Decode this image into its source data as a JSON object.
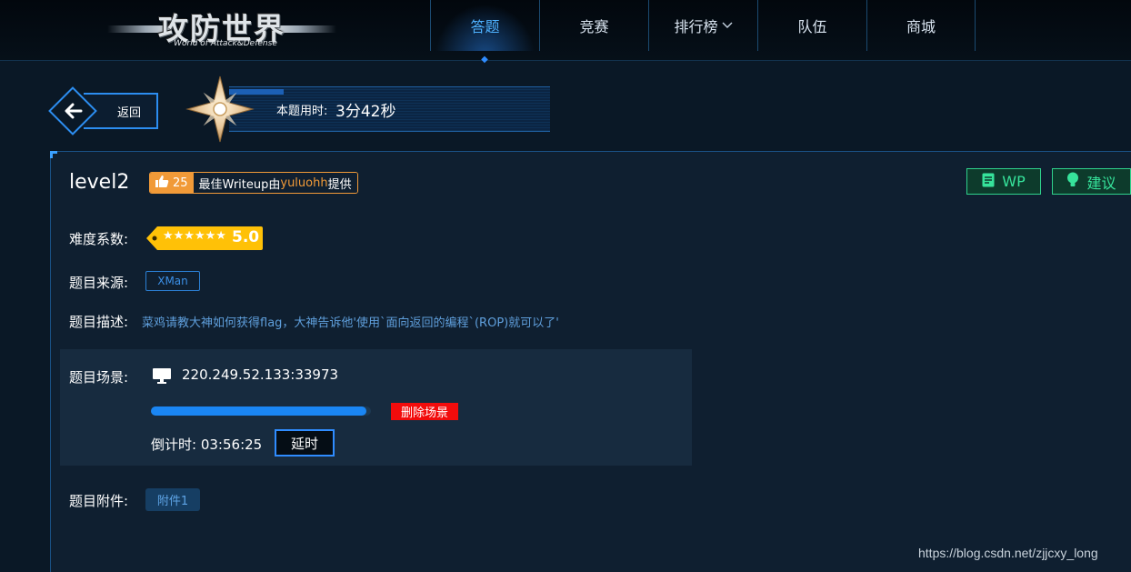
{
  "logo": {
    "title": "攻防世界",
    "subtitle": "World of Attack&Defense"
  },
  "nav": {
    "items": [
      {
        "label": "答题",
        "active": true
      },
      {
        "label": "竞赛",
        "active": false
      },
      {
        "label": "排行榜",
        "active": false,
        "has_dropdown": true
      },
      {
        "label": "队伍",
        "active": false
      },
      {
        "label": "商城",
        "active": false
      }
    ]
  },
  "back_label": "返回",
  "timer": {
    "label": "本题用时:",
    "value": "3分42秒"
  },
  "challenge": {
    "title": "level2",
    "likes": "25",
    "writeup_prefix": "最佳Writeup由",
    "writeup_user": "yuluohh",
    "writeup_suffix": "提供",
    "wp_label": "WP",
    "suggest_label": "建议",
    "difficulty_label": "难度系数:",
    "difficulty_stars": "★★★★★★",
    "difficulty_value": "5.0",
    "source_label": "题目来源:",
    "source": "XMan",
    "desc_label": "题目描述:",
    "description": "菜鸡请教大神如何获得flag，大神告诉他'使用`面向返回的编程`(ROP)就可以了'",
    "scene_label": "题目场景:",
    "scene_address": "220.249.52.133:33973",
    "scene_progress": 0.98,
    "delete_scene_label": "删除场景",
    "countdown_label": "倒计时:",
    "countdown_value": "03:56:25",
    "extend_label": "延时",
    "attach_label": "题目附件:",
    "attachment": "附件1"
  },
  "watermark": "https://blog.csdn.net/zjjcxy_long",
  "colors": {
    "accent_blue": "#2f8cff",
    "like_orange": "#f19a38",
    "wp_green": "#36e39b",
    "delete_red": "#f20c0c",
    "difficulty_gold": "#ffc107"
  },
  "icons": {
    "back": "arrow-left-icon",
    "like": "thumbs-up-icon",
    "wp": "document-icon",
    "suggest": "lightbulb-icon",
    "scene": "monitor-icon",
    "badge": "compass-star-icon"
  }
}
